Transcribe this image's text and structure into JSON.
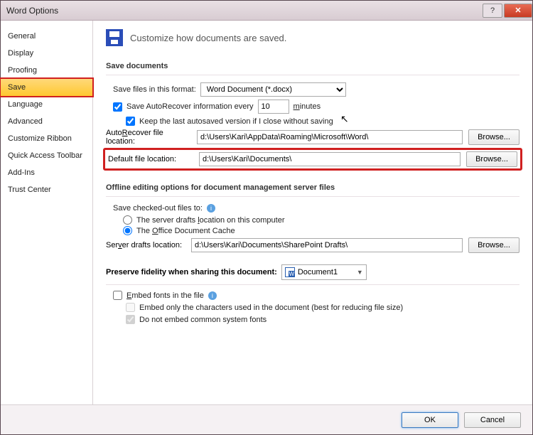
{
  "title": "Word Options",
  "sidebar": {
    "items": [
      {
        "label": "General"
      },
      {
        "label": "Display"
      },
      {
        "label": "Proofing"
      },
      {
        "label": "Save"
      },
      {
        "label": "Language"
      },
      {
        "label": "Advanced"
      },
      {
        "label": "Customize Ribbon"
      },
      {
        "label": "Quick Access Toolbar"
      },
      {
        "label": "Add-Ins"
      },
      {
        "label": "Trust Center"
      }
    ],
    "selected_index": 3
  },
  "heading": "Customize how documents are saved.",
  "sections": {
    "save_documents": {
      "title": "Save documents",
      "format_label": "Save files in this format:",
      "format_value": "Word Document (*.docx)",
      "autorecover_label_pre": "Save AutoRecover information every",
      "autorecover_value": "10",
      "autorecover_label_post": "minutes",
      "keep_last_label": "Keep the last autosaved version if I close without saving",
      "autorecover_loc_label": "AutoRecover file location:",
      "autorecover_loc_value": "d:\\Users\\Kari\\AppData\\Roaming\\Microsoft\\Word\\",
      "default_loc_label": "Default file location:",
      "default_loc_value": "d:\\Users\\Kari\\Documents\\",
      "browse": "Browse..."
    },
    "offline": {
      "title": "Offline editing options for document management server files",
      "checked_out_label": "Save checked-out files to:",
      "radio1": "The server drafts location on this computer",
      "radio2": "The Office Document Cache",
      "drafts_label": "Server drafts location:",
      "drafts_value": "d:\\Users\\Kari\\Documents\\SharePoint Drafts\\",
      "browse": "Browse..."
    },
    "fidelity": {
      "title": "Preserve fidelity when sharing this document:",
      "doc_name": "Document1",
      "embed_label": "Embed fonts in the file",
      "embed_only_label": "Embed only the characters used in the document (best for reducing file size)",
      "no_common_label": "Do not embed common system fonts"
    }
  },
  "buttons": {
    "ok": "OK",
    "cancel": "Cancel"
  }
}
